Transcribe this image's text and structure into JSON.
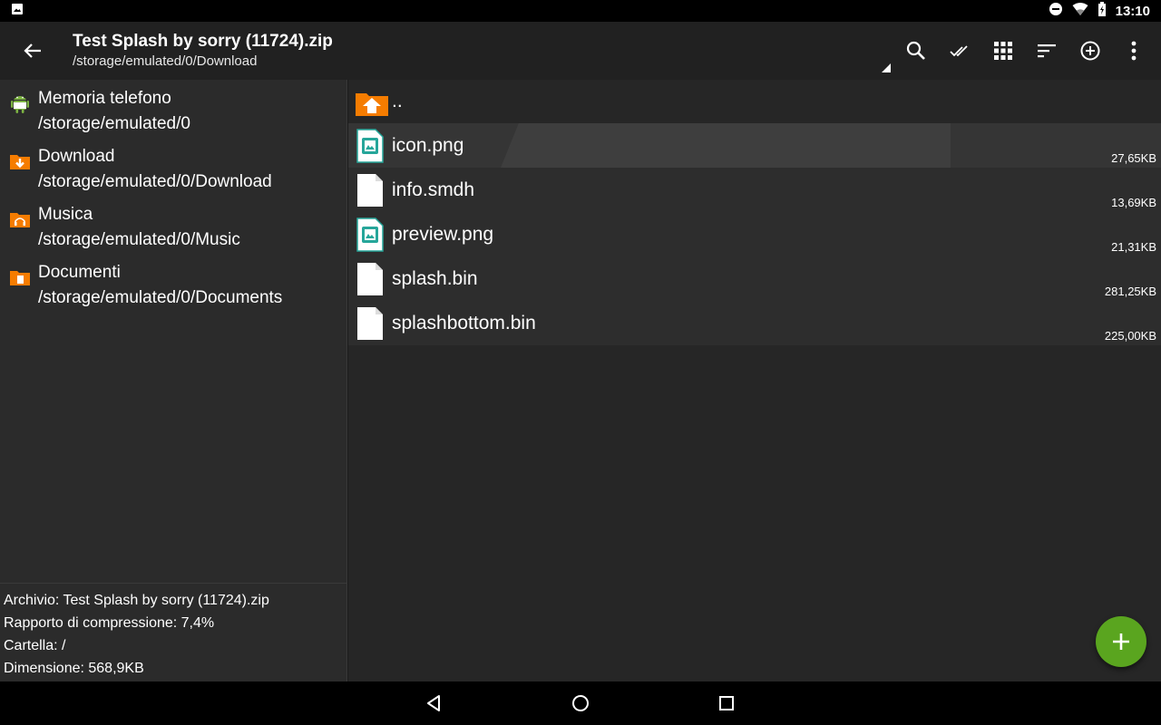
{
  "status_bar": {
    "time": "13:10",
    "icons": [
      "image-notification-icon",
      "do-not-disturb-icon",
      "wifi-icon",
      "battery-icon"
    ]
  },
  "app_bar": {
    "title": "Test Splash by sorry (11724).zip",
    "subtitle": "/storage/emulated/0/Download",
    "actions": [
      "search-icon",
      "select-all-icon",
      "grid-view-icon",
      "sort-icon",
      "add-circle-icon",
      "more-vert-icon"
    ]
  },
  "bookmarks": [
    {
      "name": "Memoria telefono",
      "path": "/storage/emulated/0",
      "icon": "android-icon",
      "color": "#7cb342"
    },
    {
      "name": "Download",
      "path": "/storage/emulated/0/Download",
      "icon": "download-folder-icon",
      "color": "#f57c00"
    },
    {
      "name": "Musica",
      "path": "/storage/emulated/0/Music",
      "icon": "music-folder-icon",
      "color": "#f57c00"
    },
    {
      "name": "Documenti",
      "path": "/storage/emulated/0/Documents",
      "icon": "documents-folder-icon",
      "color": "#f57c00"
    }
  ],
  "archive_info": {
    "archive": "Archivio: Test Splash by sorry (11724).zip",
    "ratio": "Rapporto di compressione: 7,4%",
    "folder": "Cartella: /",
    "size": "Dimensione: 568,9KB"
  },
  "files": {
    "up": "..",
    "items": [
      {
        "name": "icon.png",
        "size": "27,65KB",
        "type": "image"
      },
      {
        "name": "info.smdh",
        "size": "13,69KB",
        "type": "file"
      },
      {
        "name": "preview.png",
        "size": "21,31KB",
        "type": "image"
      },
      {
        "name": "splash.bin",
        "size": "281,25KB",
        "type": "file"
      },
      {
        "name": "splashbottom.bin",
        "size": "225,00KB",
        "type": "file"
      }
    ]
  },
  "colors": {
    "accent": "#5aa51f",
    "folder": "#f57c00",
    "image_file": "#26a69a"
  }
}
